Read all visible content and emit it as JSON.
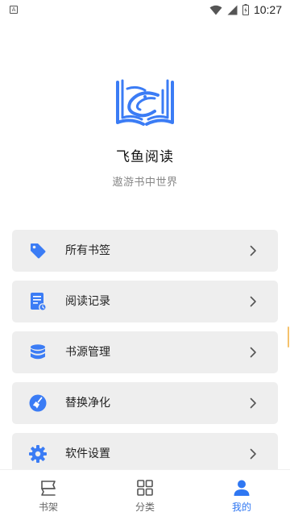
{
  "status_bar": {
    "time": "10:27",
    "left_icon": "accessibility-badge"
  },
  "brand": {
    "app_name": "飞鱼阅读",
    "slogan": "遨游书中世界",
    "accent_color": "#3b7cf5"
  },
  "menu": {
    "items": [
      {
        "label": "所有书签",
        "icon": "bookmark-tag-icon"
      },
      {
        "label": "阅读记录",
        "icon": "reading-record-icon"
      },
      {
        "label": "书源管理",
        "icon": "database-icon"
      },
      {
        "label": "替换净化",
        "icon": "broom-clean-icon"
      },
      {
        "label": "软件设置",
        "icon": "gear-icon"
      }
    ]
  },
  "bottom_nav": {
    "items": [
      {
        "label": "书架",
        "icon": "bookshelf-icon",
        "active": false
      },
      {
        "label": "分类",
        "icon": "category-grid-icon",
        "active": false
      },
      {
        "label": "我的",
        "icon": "profile-icon",
        "active": true
      }
    ]
  }
}
